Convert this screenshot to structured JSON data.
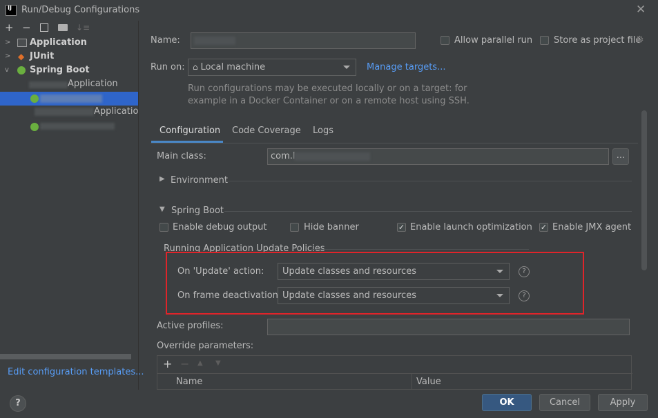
{
  "window": {
    "title": "Run/Debug Configurations",
    "app_icon_text": "IJ"
  },
  "sidebar": {
    "items": [
      {
        "label": "Application"
      },
      {
        "label": "JUnit"
      },
      {
        "label": "Spring Boot"
      }
    ],
    "children": [
      {
        "label": "Application"
      },
      {
        "label": "Applicatio"
      }
    ],
    "edit_templates_link": "Edit configuration templates..."
  },
  "form": {
    "name_label": "Name:",
    "allow_parallel_label": "Allow parallel run",
    "store_project_label": "Store as project file",
    "run_on_label": "Run on:",
    "run_on_value": "Local machine",
    "manage_targets_link": "Manage targets...",
    "run_on_desc_1": "Run configurations may be executed locally or on a target: for",
    "run_on_desc_2": "example in a Docker Container or on a remote host using SSH."
  },
  "tabs": [
    {
      "label": "Configuration"
    },
    {
      "label": "Code Coverage"
    },
    {
      "label": "Logs"
    }
  ],
  "config": {
    "main_class_label": "Main class:",
    "main_class_value": "com.l",
    "browse_label": "...",
    "environment_label": "Environment",
    "spring_boot_label": "Spring Boot",
    "enable_debug_label": "Enable debug output",
    "hide_banner_label": "Hide banner",
    "launch_opt_label": "Enable launch optimization",
    "jmx_label": "Enable JMX agent",
    "policies_label": "Running Application Update Policies",
    "on_update_label": "On 'Update' action:",
    "on_update_value": "Update classes and resources",
    "on_frame_label": "On frame deactivation:",
    "on_frame_value": "Update classes and resources",
    "help_glyph": "?",
    "active_profiles_label": "Active profiles:",
    "override_label": "Override parameters:",
    "table_col_name": "Name",
    "table_col_value": "Value"
  },
  "footer": {
    "help_glyph": "?",
    "ok_label": "OK",
    "cancel_label": "Cancel",
    "apply_label": "Apply"
  },
  "colors": {
    "background": "#3c3f41",
    "selection": "#2f65ca",
    "link": "#589df6",
    "highlight_box": "#e0242a",
    "primary_button": "#365880"
  }
}
